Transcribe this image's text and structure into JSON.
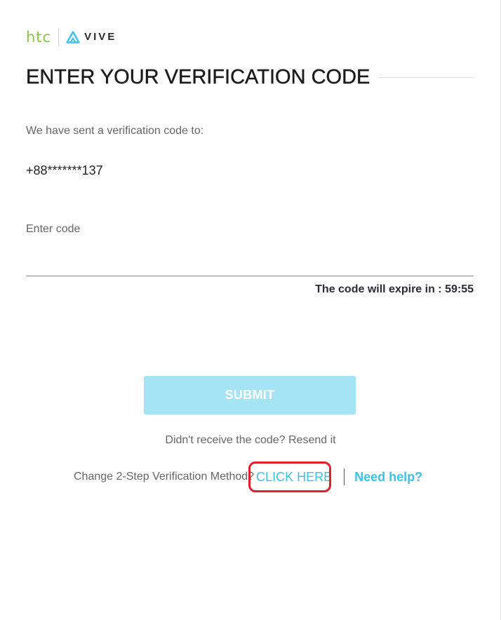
{
  "brand": {
    "htc_text": "htc",
    "vive_text": "VIVE",
    "htc_color": "#8cc63f",
    "vive_mark_color": "#3bc3e8"
  },
  "page": {
    "title": "ENTER YOUR VERIFICATION CODE",
    "sent_label": "We have sent a verification code to:",
    "phone": "+88*******137"
  },
  "code_field": {
    "label": "Enter code",
    "value": ""
  },
  "expire": {
    "text": "The code will expire in : 59:55"
  },
  "submit": {
    "label": "SUBMIT",
    "color": "#a4e4f5"
  },
  "resend": {
    "prefix": "Didn't receive the code?",
    "link": "Resend it"
  },
  "method": {
    "text": "Change 2-Step Verification Method?",
    "link": "CLICK HERE",
    "link_color": "#3bc3e8",
    "highlight_color": "#e0212b"
  },
  "help": {
    "label": "Need help?"
  }
}
